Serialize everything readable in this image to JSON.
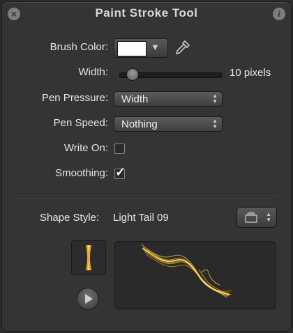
{
  "window": {
    "title": "Paint Stroke Tool"
  },
  "brush_color": {
    "label": "Brush Color:",
    "value": "#ffffff"
  },
  "width": {
    "label": "Width:",
    "value_text": "10 pixels",
    "slider_fraction": 0.08
  },
  "pen_pressure": {
    "label": "Pen Pressure:",
    "selected": "Width"
  },
  "pen_speed": {
    "label": "Pen Speed:",
    "selected": "Nothing"
  },
  "write_on": {
    "label": "Write On:",
    "checked": false
  },
  "smoothing": {
    "label": "Smoothing:",
    "checked": true
  },
  "shape_style": {
    "label": "Shape Style:",
    "value": "Light Tail 09"
  },
  "colors": {
    "stroke_glow": "#f5b41a",
    "stroke_core": "#ffe07a",
    "panel": "#343434"
  }
}
